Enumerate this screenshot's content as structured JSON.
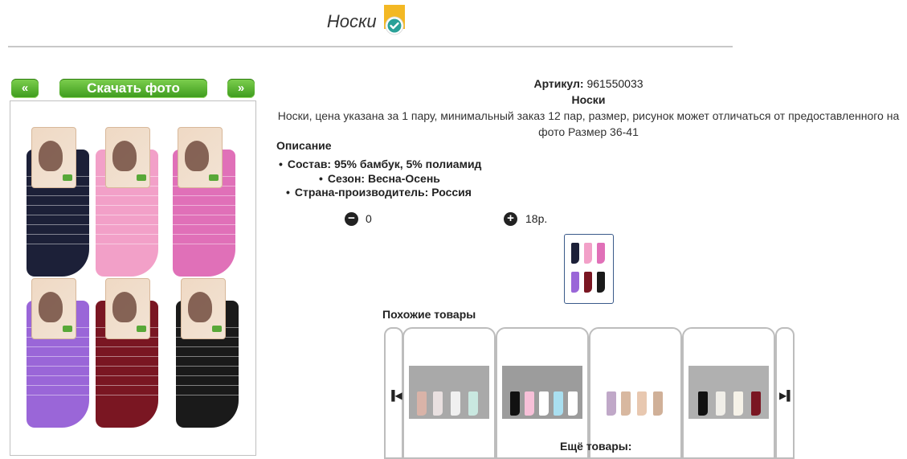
{
  "title": "Носки",
  "gallery": {
    "prev_label": "«",
    "next_label": "»",
    "download_label": "Скачать фото"
  },
  "product": {
    "article_label": "Артикул:",
    "article_value": "961550033",
    "name": "Носки",
    "description_line1": "Носки, цена указана за 1 пару, минимальный заказ 12 пар, размер, рисунок может отличаться от предоставленного на",
    "description_line2": "фото Размер 36-41",
    "section_title": "Описание",
    "specs": [
      "Состав: 95% бамбук, 5% полиамид",
      "Сезон: Весна-Осень",
      "Страна-производитель: Россия"
    ],
    "quantity": "0",
    "price": "18р."
  },
  "similar": {
    "title": "Похожие товары",
    "more_label": "Ещё товары:"
  },
  "icons": {
    "check": "check-badge-icon",
    "minus": "minus-circle-icon",
    "plus": "plus-circle-icon",
    "left": "carousel-prev-icon",
    "right": "carousel-next-icon"
  },
  "colors": {
    "button_green": "#4aa925",
    "sock_colors": [
      "#1c2038",
      "#f2a0c8",
      "#e070b8",
      "#9a66d8",
      "#7a1622",
      "#1a1a1a"
    ]
  }
}
